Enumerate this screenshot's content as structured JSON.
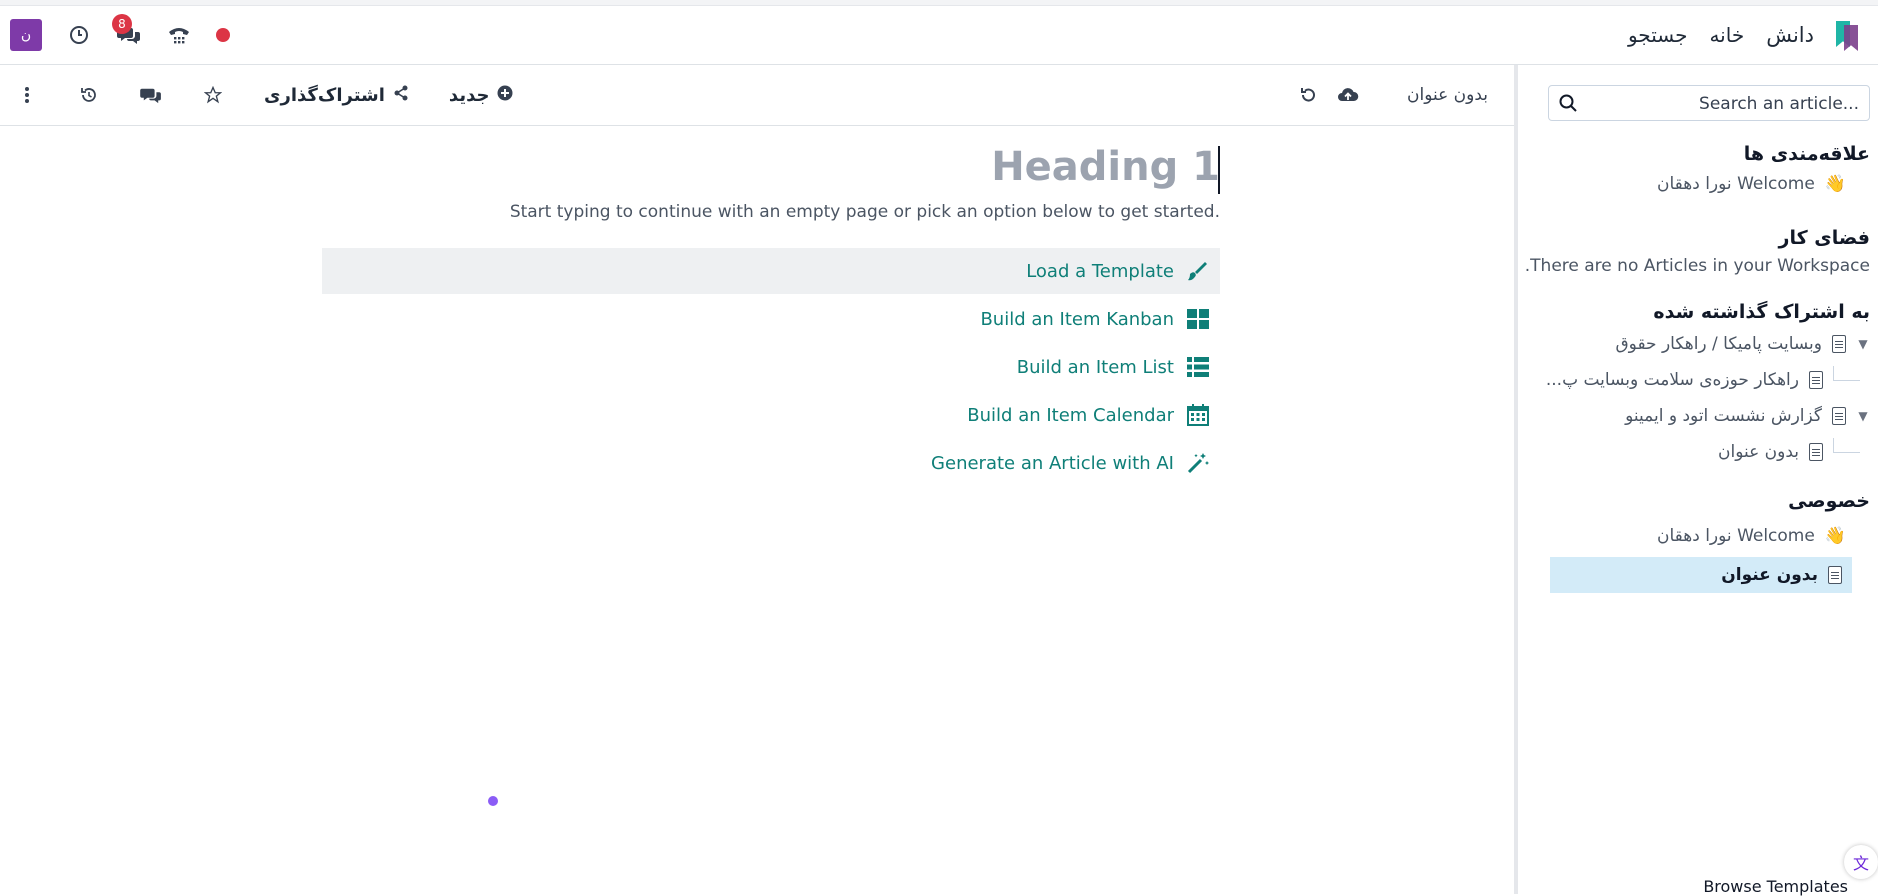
{
  "nav": {
    "brand": "دانش",
    "home": "خانه",
    "search": "جستجو",
    "avatar_letter": "ن",
    "chat_badge": "8"
  },
  "toolbar": {
    "doc_title": "بدون عنوان",
    "new_label": "جدید",
    "share_label": "اشتراک‌گذاری"
  },
  "editor": {
    "heading_placeholder": "Heading 1",
    "hint": "Start typing to continue with an empty page or pick an option below to get started.",
    "options": [
      {
        "label": "Load a Template",
        "icon": "paintbrush-icon"
      },
      {
        "label": "Build an Item Kanban",
        "icon": "kanban-icon"
      },
      {
        "label": "Build an Item List",
        "icon": "list-icon"
      },
      {
        "label": "Build an Item Calendar",
        "icon": "calendar-icon"
      },
      {
        "label": "Generate an Article with AI",
        "icon": "magic-wand-icon"
      }
    ]
  },
  "sidebar": {
    "search_placeholder": "Search an article...",
    "favorites": {
      "title": "علاقه‌مندی ها",
      "items": [
        {
          "label": "Welcome نورا دهقان"
        }
      ]
    },
    "workspace": {
      "title": "فضای کار",
      "empty": "There are no Articles in your Workspace."
    },
    "shared": {
      "title": "به اشتراک گذاشته شده",
      "items": [
        {
          "label": "وبسایت پامیکا / راهکار حقوق"
        },
        {
          "label": "راهکار حوزه‌ی سلامت وبسایت پ..."
        },
        {
          "label": "گزارش نشست اتود و ایمینو"
        },
        {
          "label": "بدون عنوان"
        }
      ]
    },
    "private": {
      "title": "خصوصی",
      "items": [
        {
          "label": "Welcome نورا دهقان"
        },
        {
          "label": "بدون عنوان"
        }
      ]
    },
    "browse_templates": "Browse Templates"
  },
  "colors": {
    "accent_teal": "#0f7f78",
    "avatar": "#7e3aa8",
    "badge": "#dc3545",
    "active_item": "#d3ebf8"
  }
}
